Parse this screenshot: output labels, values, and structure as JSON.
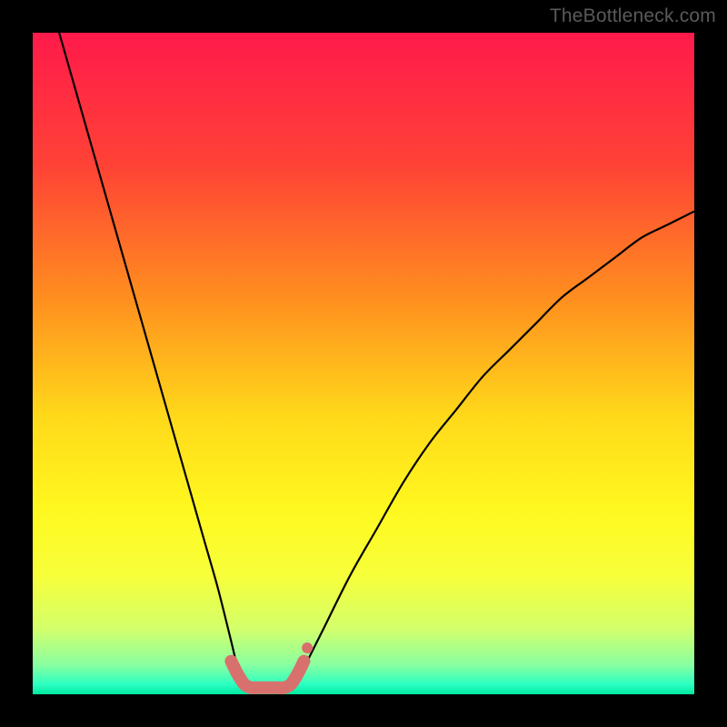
{
  "watermark": "TheBottleneck.com",
  "chart_data": {
    "type": "line",
    "title": "",
    "xlabel": "",
    "ylabel": "",
    "xlim": [
      0,
      100
    ],
    "ylim": [
      0,
      100
    ],
    "grid": false,
    "legend": false,
    "gradient_stops": [
      {
        "offset": 0.0,
        "color": "#ff1a4b"
      },
      {
        "offset": 0.2,
        "color": "#ff4236"
      },
      {
        "offset": 0.4,
        "color": "#ff8e1f"
      },
      {
        "offset": 0.58,
        "color": "#ffd91a"
      },
      {
        "offset": 0.72,
        "color": "#fff81f"
      },
      {
        "offset": 0.82,
        "color": "#f7ff3a"
      },
      {
        "offset": 0.9,
        "color": "#d4ff6a"
      },
      {
        "offset": 0.955,
        "color": "#8affa0"
      },
      {
        "offset": 0.985,
        "color": "#2cffc2"
      },
      {
        "offset": 1.0,
        "color": "#00e8a0"
      }
    ],
    "series": [
      {
        "name": "bottleneck-curve-left",
        "color": "#000000",
        "x": [
          4,
          6,
          8,
          10,
          12,
          14,
          16,
          18,
          20,
          22,
          24,
          26,
          28,
          30,
          31,
          32,
          33
        ],
        "y": [
          100,
          93,
          86,
          79,
          72,
          65,
          58,
          51,
          44,
          37,
          30,
          23,
          16,
          8,
          4,
          2,
          1
        ]
      },
      {
        "name": "bottleneck-curve-right",
        "color": "#000000",
        "x": [
          39,
          40,
          41,
          42,
          44,
          48,
          52,
          56,
          60,
          64,
          68,
          72,
          76,
          80,
          84,
          88,
          92,
          96,
          100
        ],
        "y": [
          1,
          2,
          4,
          6,
          10,
          18,
          25,
          32,
          38,
          43,
          48,
          52,
          56,
          60,
          63,
          66,
          69,
          71,
          73
        ]
      }
    ],
    "flat_segment": {
      "name": "optimal-range-marker",
      "color": "#d8706e",
      "x": [
        30,
        31,
        32,
        33,
        34,
        35,
        36,
        37,
        38,
        39,
        40,
        41
      ],
      "y": [
        5,
        3,
        1.5,
        1,
        1,
        1,
        1,
        1,
        1,
        1.5,
        3,
        5
      ]
    }
  }
}
